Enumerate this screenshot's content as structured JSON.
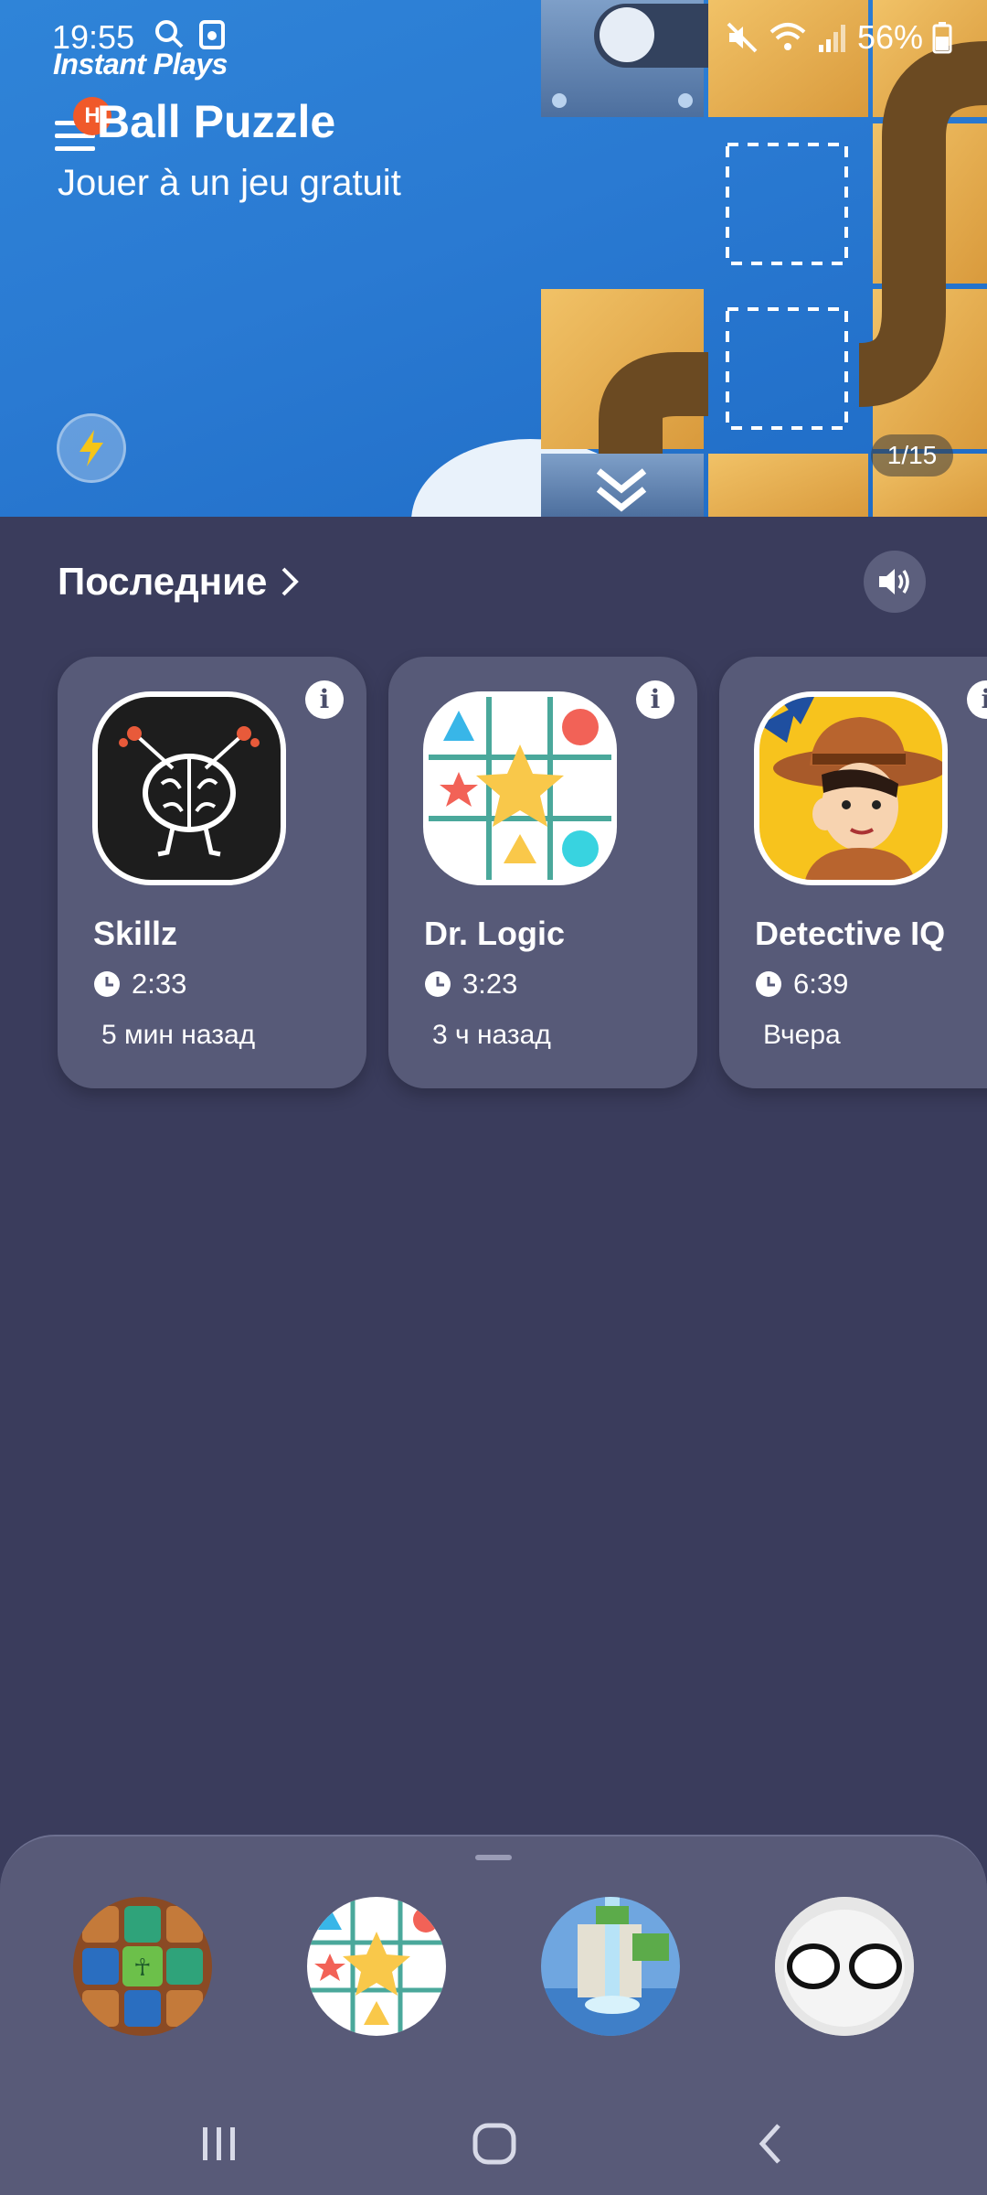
{
  "status_bar": {
    "time": "19:55",
    "battery": "56%"
  },
  "hero": {
    "brand": "Instant Plays",
    "badge_letter": "H",
    "title": "Ball Puzzle",
    "subtitle": "Jouer à un jeu gratuit",
    "page_indicator": "1/15"
  },
  "recent": {
    "header": "Последние",
    "cards": [
      {
        "title": "Skillz",
        "time": "2:33",
        "ago": "5 мин назад",
        "icon": "brain-icon"
      },
      {
        "title": "Dr. Logic",
        "time": "3:23",
        "ago": "3 ч назад",
        "icon": "shapes-grid-icon"
      },
      {
        "title": "Detective IQ",
        "time": "6:39",
        "ago": "Вчера",
        "icon": "detective-icon"
      }
    ]
  },
  "drawer": {
    "games": [
      "tile-puzzle-icon",
      "shapes-grid-icon",
      "waterfall-icon",
      "ghost-eyes-icon"
    ]
  },
  "colors": {
    "background": "#3a3c5c",
    "card": "#575a78",
    "hero_blue": "#2a7ad2",
    "badge": "#f0592a"
  }
}
